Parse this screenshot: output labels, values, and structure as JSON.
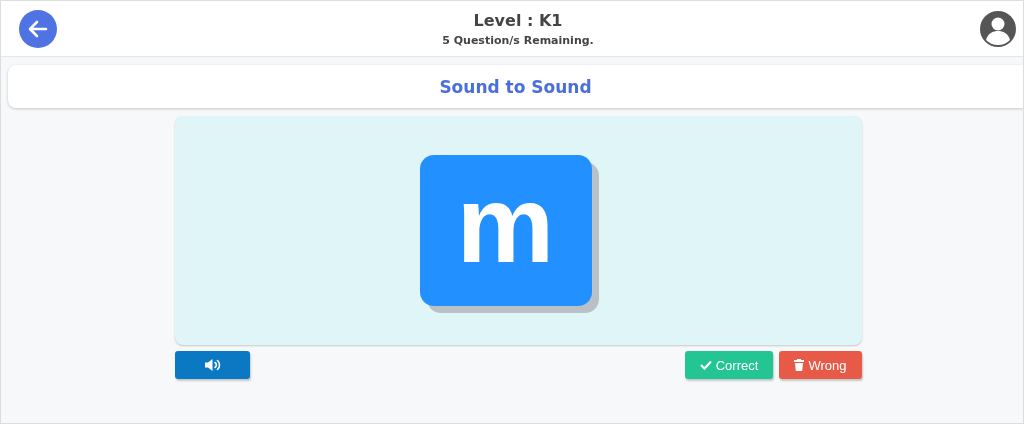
{
  "header": {
    "title": "Level : K1",
    "subtitle": "5 Question/s Remaining."
  },
  "activity": {
    "title": "Sound to Sound"
  },
  "card": {
    "letter": "m"
  },
  "buttons": [
    {
      "kind": "sound"
    },
    {
      "kind": "correct",
      "label": "Correct"
    },
    {
      "kind": "wrong",
      "label": "Wrong"
    }
  ]
}
